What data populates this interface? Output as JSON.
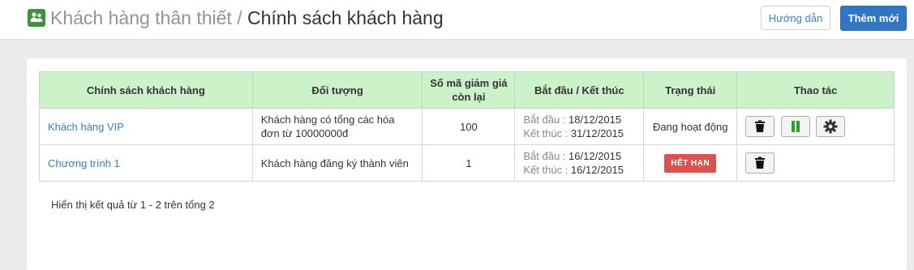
{
  "header": {
    "app_icon": "loyal-customers-icon",
    "breadcrumb_parent": "Khách hàng thân thiết",
    "separator": "/",
    "page_title": "Chính sách khách hàng",
    "help_label": "Hướng dẫn",
    "new_label": "Thêm mới",
    "new_color": "#3276c3",
    "header_green": "#ccf2c9"
  },
  "table": {
    "columns": [
      "Chính sách khách hàng",
      "Đối tượng",
      "Số mã giảm giá còn lại",
      "Bắt đầu / Kết thúc",
      "Trạng thái",
      "Thao tác"
    ],
    "rows": [
      {
        "policy": "Khách hàng VIP",
        "target": "Khách hàng có tổng các hóa đơn từ 10000000đ",
        "codes_left": "100",
        "start_label": "Bắt đầu :",
        "start": "18/12/2015",
        "end_label": "Kết thúc :",
        "end": "31/12/2015",
        "status": "Đang hoạt động",
        "actions": [
          "trash-icon",
          "pause-icon",
          "gear-icon"
        ]
      },
      {
        "policy": "Chương trình 1",
        "target": "Khách hàng đăng ký thành viên",
        "codes_left": "1",
        "start_label": "Bắt đầu :",
        "start": "16/12/2015",
        "end_label": "Kết thúc :",
        "end": "16/12/2015",
        "status": "HẾT HẠN",
        "status_color": "#d9534f",
        "actions": [
          "trash-icon"
        ]
      }
    ]
  },
  "summary": "Hiển thị kết quả từ 1 - 2 trên tổng 2"
}
